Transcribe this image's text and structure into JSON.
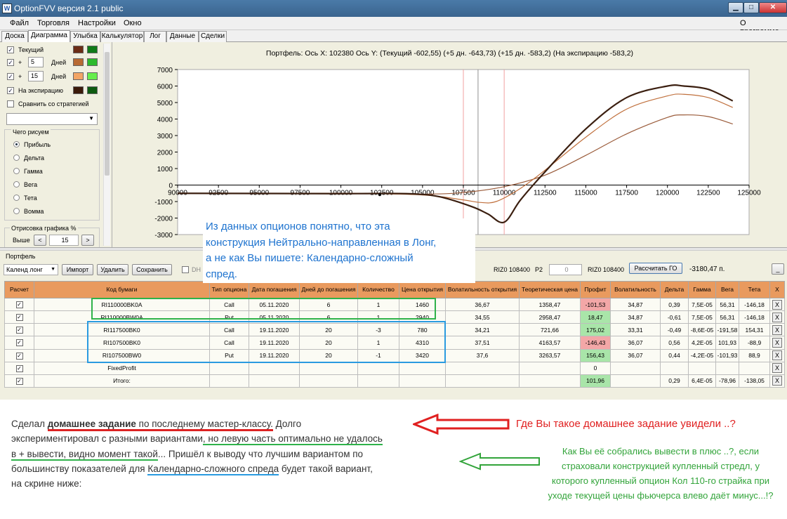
{
  "window": {
    "app_icon": "W",
    "title": "OptionFVV версия 2.1 public"
  },
  "menu": {
    "items": [
      "Файл",
      "Торговля",
      "Настройки",
      "Окно"
    ],
    "about": "О программе"
  },
  "tabs": [
    "Доска",
    "Диаграмма",
    "Улыбка",
    "Калькулятор",
    "Лог",
    "Данные",
    "Сделки"
  ],
  "left_panel": {
    "current": {
      "label": "Текущий",
      "checked": true,
      "colors": [
        "#6b2c15",
        "#107a18"
      ]
    },
    "plus5": {
      "plus": "+",
      "days": "5",
      "unit": "Дней",
      "checked": true,
      "colors": [
        "#b86a33",
        "#2dba2d"
      ]
    },
    "plus15": {
      "plus": "+",
      "days": "15",
      "unit": "Дней",
      "checked": true,
      "colors": [
        "#f2a465",
        "#66ee4d"
      ]
    },
    "expiration": {
      "label": "На экспирацию",
      "checked": true,
      "colors": [
        "#3b1a0a",
        "#0d5a10"
      ]
    },
    "compare": {
      "label": "Сравнить со стратегией",
      "checked": false
    },
    "group_label": "Чего рисуем",
    "radios": [
      {
        "label": "Прибыль",
        "selected": true
      },
      {
        "label": "Дельта",
        "selected": false
      },
      {
        "label": "Гамма",
        "selected": false
      },
      {
        "label": "Вега",
        "selected": false
      },
      {
        "label": "Тета",
        "selected": false
      },
      {
        "label": "Вомма",
        "selected": false
      }
    ],
    "draw_label": "Отрисовка графика %",
    "higher_label": "Выше",
    "higher_prev": "<",
    "higher_value": "15",
    "higher_next": ">"
  },
  "chart_title": "Портфель: Ось X: 102380 Ось Y:  (Текущий -602,55)  (+5 дн. -643,73)  (+15 дн. -583,2)  (На экспирацию -583,2)",
  "chart_data": {
    "type": "line",
    "xlim": [
      90000,
      125000
    ],
    "ylim": [
      -3000,
      7000
    ],
    "x_ticks": [
      "90000",
      "92500",
      "95000",
      "97500",
      "100000",
      "102500",
      "105000",
      "107500",
      "110000",
      "112500",
      "115000",
      "117500",
      "120000",
      "122500",
      "125000"
    ],
    "y_ticks": [
      "7000",
      "6000",
      "5000",
      "4000",
      "3000",
      "2000",
      "1000",
      "0",
      "-1000",
      "-2000",
      "-3000"
    ],
    "vertical_lines": [
      {
        "x": 107500,
        "color": "#f0a0a0"
      },
      {
        "x": 108400,
        "color": "#909090"
      },
      {
        "x": 110000,
        "color": "#f0a0a0"
      }
    ],
    "cursor_point": {
      "x": 102380,
      "y": -583
    },
    "series": [
      {
        "x": [
          90000,
          100000,
          104000,
          106000,
          108000,
          109000,
          110000,
          111000,
          112500,
          115000,
          117500,
          120000,
          121000,
          122500,
          124000
        ],
        "y": [
          -500,
          -520,
          -520,
          -700,
          -1300,
          -1750,
          -2250,
          -900,
          800,
          3400,
          5300,
          6000,
          6000,
          5800,
          5100
        ],
        "color": "#3b1f10",
        "width": 2.2
      },
      {
        "x": [
          90000,
          100000,
          105000,
          107500,
          108500,
          109500,
          111000,
          112500,
          115000,
          117500,
          120000,
          121000,
          122500,
          124000
        ],
        "y": [
          -500,
          -500,
          -600,
          -900,
          -1050,
          -1000,
          -200,
          900,
          2900,
          4600,
          5400,
          5500,
          5300,
          4700
        ],
        "color": "#c0703d",
        "width": 1.2
      },
      {
        "x": [
          90000,
          100000,
          105000,
          107500,
          110000,
          112500,
          115000,
          117500,
          120000,
          121000,
          122500,
          124000
        ],
        "y": [
          -500,
          -500,
          -550,
          -450,
          -100,
          600,
          1800,
          3100,
          4100,
          4250,
          4150,
          3700
        ],
        "color": "#9a5b3a",
        "width": 1.2
      }
    ]
  },
  "callout": {
    "lines": [
      "Из данных опционов понятно, что эта",
      "конструкция Нейтрально-направленная в Лонг,",
      "а не как Вы пишете: Календарно-сложный",
      "спред."
    ]
  },
  "portfolio": {
    "group_label": "Портфель",
    "strategy_select": "Календ лонг",
    "buttons": {
      "import": "Импорт",
      "delete": "Удалить",
      "save": "Сохранить",
      "calc": "Рассчитать ГО",
      "small": "_"
    },
    "dh_label": "DH",
    "p2_label": "P2",
    "riz_label_1": "RIZ0 108400",
    "riz_label_2": "RIZ0 108400",
    "p2_value": "0",
    "go_value": "-3180,47 п.",
    "columns": [
      "Расчет",
      "Код бумаги",
      "Тип опциона",
      "Дата погашения",
      "Дней до погашения",
      "Количество",
      "Цена открытия",
      "Волатильность открытия",
      "Теоретическая цена",
      "Профит",
      "Волатильность",
      "Дельта",
      "Гамма",
      "Вега",
      "Тета",
      "X"
    ],
    "rows": [
      {
        "code": "RI110000BK0A",
        "type": "Call",
        "date": "05.11.2020",
        "days": "6",
        "qty": "1",
        "price": "1460",
        "vol_open": "36,67",
        "theor": "1358,47",
        "profit": "-101,53",
        "profit_class": "red",
        "vol": "34,87",
        "delta": "0,39",
        "gamma": "7,5E-05",
        "vega": "56,31",
        "theta": "-146,18",
        "check": "✓",
        "x": "X"
      },
      {
        "code": "RI110000BW0A",
        "type": "Put",
        "date": "05.11.2020",
        "days": "6",
        "qty": "1",
        "price": "2940",
        "vol_open": "34,55",
        "theor": "2958,47",
        "profit": "18,47",
        "profit_class": "green",
        "vol": "34,87",
        "delta": "-0,61",
        "gamma": "7,5E-05",
        "vega": "56,31",
        "theta": "-146,18",
        "check": "✓",
        "x": "X"
      },
      {
        "code": "RI117500BK0",
        "type": "Call",
        "date": "19.11.2020",
        "days": "20",
        "qty": "-3",
        "price": "780",
        "vol_open": "34,21",
        "theor": "721,66",
        "profit": "175,02",
        "profit_class": "green",
        "vol": "33,31",
        "delta": "-0,49",
        "gamma": "-8,6E-05",
        "vega": "-191,58",
        "theta": "154,31",
        "check": "✓",
        "x": "X"
      },
      {
        "code": "RI107500BK0",
        "type": "Call",
        "date": "19.11.2020",
        "days": "20",
        "qty": "1",
        "price": "4310",
        "vol_open": "37,51",
        "theor": "4163,57",
        "profit": "-146,43",
        "profit_class": "red",
        "vol": "36,07",
        "delta": "0,56",
        "gamma": "4,2E-05",
        "vega": "101,93",
        "theta": "-88,9",
        "check": "✓",
        "x": "X"
      },
      {
        "code": "RI107500BW0",
        "type": "Put",
        "date": "19.11.2020",
        "days": "20",
        "qty": "-1",
        "price": "3420",
        "vol_open": "37,6",
        "theor": "3263,57",
        "profit": "156,43",
        "profit_class": "green",
        "vol": "36,07",
        "delta": "0,44",
        "gamma": "-4,2E-05",
        "vega": "-101,93",
        "theta": "88,9",
        "check": "✓",
        "x": "X"
      },
      {
        "code": "FixedProfit",
        "type": "",
        "date": "",
        "days": "",
        "qty": "",
        "price": "",
        "vol_open": "",
        "theor": "",
        "profit": "0",
        "profit_class": "",
        "vol": "",
        "delta": "",
        "gamma": "",
        "vega": "",
        "theta": "",
        "check": "✓",
        "x": "X"
      },
      {
        "code": "Итого:",
        "type": "",
        "date": "",
        "days": "",
        "qty": "",
        "price": "",
        "vol_open": "",
        "theor": "",
        "profit": "101,96",
        "profit_class": "green",
        "vol": "",
        "delta": "0,29",
        "gamma": "6,4E-05",
        "vega": "-78,96",
        "theta": "-138,05",
        "check": "✓",
        "x": "X"
      }
    ]
  },
  "bottom": {
    "l1a": "Сделал ",
    "l1b": "домашнее задание",
    "l1c": " по последнему мастер-классу.",
    "l1d": "  Долго",
    "l2a": "экспериментировал с разными вариантами",
    "l2b": ", но левую часть оптимально не удалось",
    "l3a": "в + вывести, видно момент такой",
    "l3b": "... Пришёл к выводу что лучшим вариантом по",
    "l4": "большинству показателей для ",
    "l4b": "Календарно-сложного спреда",
    "l4c": " будет такой вариант,",
    "l5": "на скрине ниже:",
    "red_question": "Где Вы такое домашнее задание увидели ..?",
    "green_comment": "Как Вы её собрались вывести в плюс ..?, если страховали конструкцией купленный стредл, у которого купленный опцион Кол 110-го страйка при уходе текущей цены фьючерса влево даёт минус...!?"
  }
}
